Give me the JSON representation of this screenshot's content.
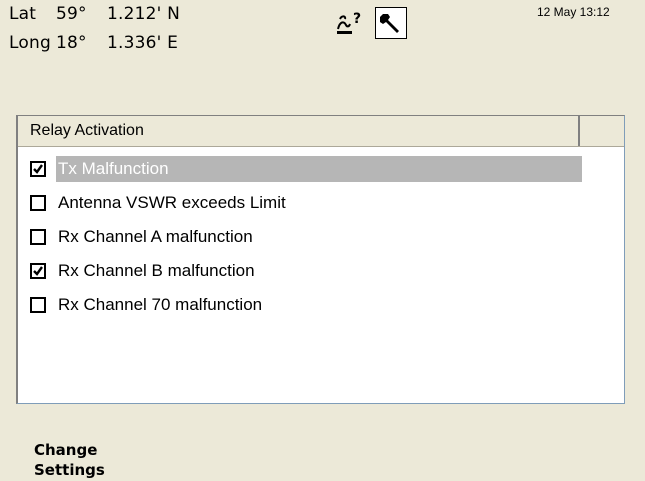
{
  "position": {
    "lat_label": "Lat",
    "lat_deg": "59°",
    "lat_min": "1.212' N",
    "long_label": "Long",
    "long_deg": "18°",
    "long_min": "1.336' E"
  },
  "datetime": "12 May 13:12",
  "icons": [
    "help-icon",
    "wrench-icon"
  ],
  "relay": {
    "header": "Relay Activation",
    "items": [
      {
        "label": "Tx Malfunction",
        "checked": true,
        "selected": true
      },
      {
        "label": "Antenna VSWR exceeds Limit",
        "checked": false,
        "selected": false
      },
      {
        "label": "Rx Channel A malfunction",
        "checked": false,
        "selected": false
      },
      {
        "label": "Rx Channel B malfunction",
        "checked": true,
        "selected": false
      },
      {
        "label": "Rx Channel 70 malfunction",
        "checked": false,
        "selected": false
      }
    ]
  },
  "softkey": {
    "line1": "Change",
    "line2": "Settings"
  }
}
